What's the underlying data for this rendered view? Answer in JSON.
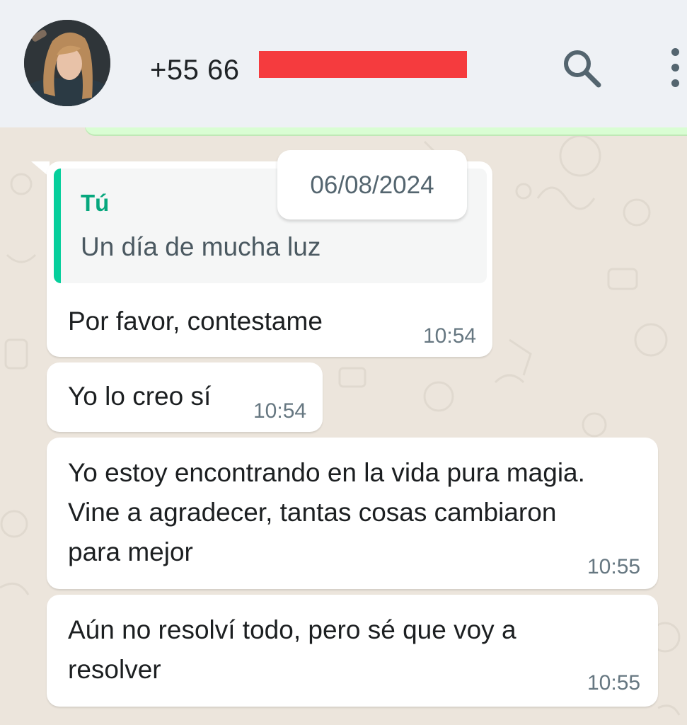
{
  "header": {
    "contact_name": "+55 66",
    "search_icon": "search-icon",
    "menu_icon": "more-vertical-icon"
  },
  "date_separator": "06/08/2024",
  "messages": [
    {
      "quoted": {
        "author": "Tú",
        "text": "Un día de mucha luz"
      },
      "text": "Por favor, contestame",
      "time": "10:54"
    },
    {
      "text": "Yo lo creo sí",
      "time": "10:54"
    },
    {
      "lines": [
        "Yo estoy encontrando en la vida pura magia.",
        "Vine a agradecer, tantas cosas cambiaron",
        "para mejor"
      ],
      "time": "10:55"
    },
    {
      "lines": [
        "Aún no resolví todo, pero sé que voy a",
        "resolver"
      ],
      "time": "10:55"
    }
  ],
  "colors": {
    "header_bg": "#eef1f5",
    "chat_bg": "#ece5dc",
    "bubble_in": "#ffffff",
    "quote_accent": "#06cf9c",
    "outgoing_bubble": "#d9fdd3",
    "redaction": "#f53b3e"
  }
}
